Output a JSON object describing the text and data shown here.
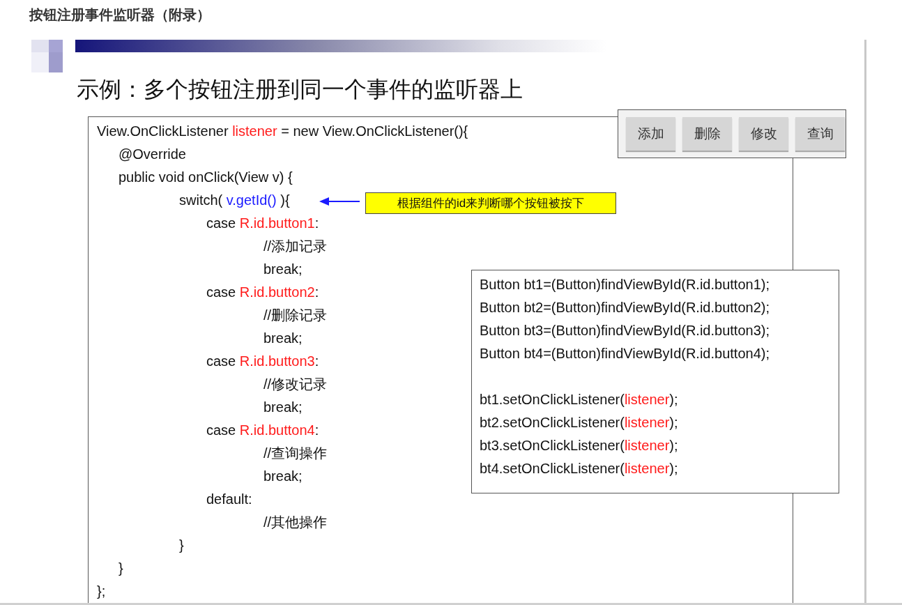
{
  "page_heading": "按钮注册事件监听器（附录）",
  "slide": {
    "subtitle": "示例：多个按钮注册到同一个事件的监听器上",
    "code": [
      {
        "segments": [
          {
            "kind": "plain",
            "text": "View.OnClickListener "
          },
          {
            "kind": "identifier",
            "text": "listener"
          },
          {
            "kind": "plain",
            "text": " = new View.OnClickListener(){"
          }
        ],
        "children": [
          {
            "segments": [
              {
                "kind": "plain",
                "text": "@Override"
              }
            ]
          },
          {
            "segments": [
              {
                "kind": "plain",
                "text": "public void onClick(View v) {"
              }
            ],
            "children": [
              {
                "segments": [
                  {
                    "kind": "plain",
                    "text": "switch( "
                  },
                  {
                    "kind": "expression",
                    "text": "v.getId()"
                  },
                  {
                    "kind": "plain",
                    "text": " ){"
                  }
                ],
                "children": [
                  {
                    "segments": [
                      {
                        "kind": "plain",
                        "text": "case "
                      },
                      {
                        "kind": "identifier",
                        "text": "R.id.button1"
                      },
                      {
                        "kind": "plain",
                        "text": ":"
                      }
                    ],
                    "children": [
                      {
                        "segments": [
                          {
                            "kind": "plain",
                            "text": "//添加记录"
                          }
                        ]
                      },
                      {
                        "segments": [
                          {
                            "kind": "plain",
                            "text": "break;"
                          }
                        ]
                      }
                    ]
                  },
                  {
                    "segments": [
                      {
                        "kind": "plain",
                        "text": "case "
                      },
                      {
                        "kind": "identifier",
                        "text": "R.id.button2"
                      },
                      {
                        "kind": "plain",
                        "text": ":"
                      }
                    ],
                    "children": [
                      {
                        "segments": [
                          {
                            "kind": "plain",
                            "text": "//删除记录"
                          }
                        ]
                      },
                      {
                        "segments": [
                          {
                            "kind": "plain",
                            "text": "break;"
                          }
                        ]
                      }
                    ]
                  },
                  {
                    "segments": [
                      {
                        "kind": "plain",
                        "text": "case "
                      },
                      {
                        "kind": "identifier",
                        "text": "R.id.button3"
                      },
                      {
                        "kind": "plain",
                        "text": ":"
                      }
                    ],
                    "children": [
                      {
                        "segments": [
                          {
                            "kind": "plain",
                            "text": "//修改记录"
                          }
                        ]
                      },
                      {
                        "segments": [
                          {
                            "kind": "plain",
                            "text": "break;"
                          }
                        ]
                      }
                    ]
                  },
                  {
                    "segments": [
                      {
                        "kind": "plain",
                        "text": "case "
                      },
                      {
                        "kind": "identifier",
                        "text": "R.id.button4"
                      },
                      {
                        "kind": "plain",
                        "text": ":"
                      }
                    ],
                    "children": [
                      {
                        "segments": [
                          {
                            "kind": "plain",
                            "text": "//查询操作"
                          }
                        ]
                      },
                      {
                        "segments": [
                          {
                            "kind": "plain",
                            "text": "break;"
                          }
                        ]
                      }
                    ]
                  },
                  {
                    "segments": [
                      {
                        "kind": "plain",
                        "text": "default:"
                      }
                    ],
                    "children": [
                      {
                        "segments": [
                          {
                            "kind": "plain",
                            "text": "//其他操作"
                          }
                        ]
                      }
                    ]
                  }
                ]
              },
              {
                "segments": [
                  {
                    "kind": "plain",
                    "text": "}"
                  }
                ]
              }
            ]
          },
          {
            "segments": [
              {
                "kind": "plain",
                "text": "}"
              }
            ]
          }
        ]
      },
      {
        "segments": [
          {
            "kind": "plain",
            "text": "};"
          }
        ]
      }
    ],
    "app_buttons": [
      "添加",
      "删除",
      "修改",
      "查询"
    ],
    "callout": "根据组件的id来判断哪个按钮被按下",
    "setup_code": [
      [
        [
          {
            "kind": "plain",
            "text": "Button bt1=(Button)findViewById(R.id.button1);"
          }
        ],
        [
          {
            "kind": "plain",
            "text": "Button bt2=(Button)findViewById(R.id.button2);"
          }
        ],
        [
          {
            "kind": "plain",
            "text": "Button bt3=(Button)findViewById(R.id.button3);"
          }
        ],
        [
          {
            "kind": "plain",
            "text": "Button bt4=(Button)findViewById(R.id.button4);"
          }
        ]
      ],
      [
        [
          {
            "kind": "plain",
            "text": "bt1.setOnClickListener("
          },
          {
            "kind": "identifier",
            "text": "listener"
          },
          {
            "kind": "plain",
            "text": ");"
          }
        ],
        [
          {
            "kind": "plain",
            "text": "bt2.setOnClickListener("
          },
          {
            "kind": "identifier",
            "text": "listener"
          },
          {
            "kind": "plain",
            "text": ");"
          }
        ],
        [
          {
            "kind": "plain",
            "text": "bt3.setOnClickListener("
          },
          {
            "kind": "identifier",
            "text": "listener"
          },
          {
            "kind": "plain",
            "text": ");"
          }
        ],
        [
          {
            "kind": "plain",
            "text": "bt4.setOnClickListener("
          },
          {
            "kind": "identifier",
            "text": "listener"
          },
          {
            "kind": "plain",
            "text": ");"
          }
        ]
      ]
    ]
  }
}
